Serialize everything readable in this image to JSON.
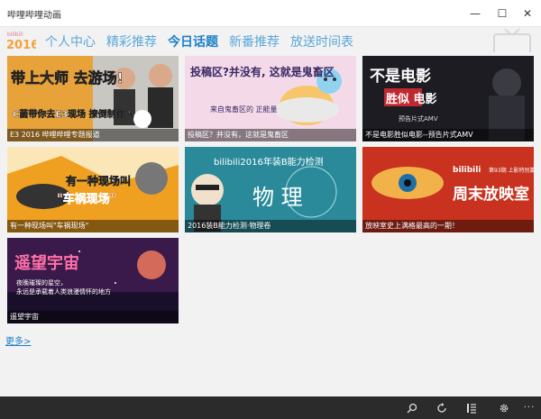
{
  "window": {
    "title": "哔哩哔哩动画",
    "minimize_glyph": "—",
    "maximize_glyph": "☐",
    "close_glyph": "✕"
  },
  "logo": {
    "text_top": "bilibili",
    "text_year": "2016"
  },
  "nav": {
    "tabs": [
      {
        "label": "个人中心",
        "active": false
      },
      {
        "label": "精彩推荐",
        "active": false
      },
      {
        "label": "今日话题",
        "active": true
      },
      {
        "label": "新番推荐",
        "active": false
      },
      {
        "label": "放送时间表",
        "active": false
      }
    ]
  },
  "cards": [
    {
      "caption": "E3 2016 哔哩哔哩专题报道",
      "headline": "带上大师 去游场!",
      "subline": "C菌带你去E3现场 撩倒制作人",
      "bg": "#e8a23a"
    },
    {
      "caption": "投稿区？并没有，这就是鬼畜区",
      "headline": "投稿区?并没有, 这就是鬼畜区",
      "subline": "来自鬼畜区的 正能量",
      "bg": "#f4d9e8"
    },
    {
      "caption": "不是电影胜似电影--预告片式AMV",
      "headline": "不是电影",
      "subline": "胜似 电影",
      "tagline": "预告片式AMV",
      "bg": "#1c1c22"
    },
    {
      "caption": "有一种现场叫\"车祸现场\"",
      "headline": "有一种现场叫",
      "subline": "\"车祸现场\"",
      "bg": "#f0a020"
    },
    {
      "caption": "2016装B能力检测·物理卷",
      "headline": "bilibili2016年装B能力检测",
      "subline": "物 理",
      "bg": "#2a8a9a"
    },
    {
      "caption": "放映室史上满格最高的一期！",
      "headline": "周末放映室",
      "badge": "第93期 上影特别篇",
      "brand": "bilibili",
      "bg": "#c8321e"
    },
    {
      "caption": "遥望宇宙",
      "headline": "遥望宇宙",
      "subline": "夜晚璀璨的星空，",
      "subline2": "永远是承载着人类浪漫情怀的地方",
      "bg": "#3a1a4a"
    }
  ],
  "more": {
    "label": "更多>"
  },
  "appbar": {
    "icons": [
      "search-icon",
      "refresh-icon",
      "list-icon",
      "gear-icon"
    ],
    "more_label": "···"
  },
  "colors": {
    "accent": "#1b7fc7",
    "tab": "#5aa7d9",
    "content_bg": "#f2f2f2",
    "appbar_bg": "#2b2b2b"
  }
}
